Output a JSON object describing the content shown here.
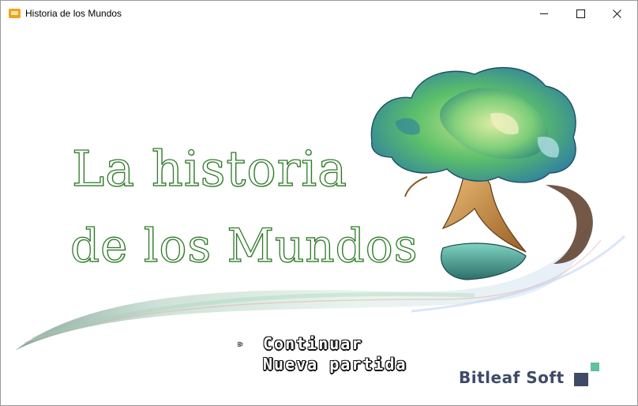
{
  "window": {
    "title": "Historia de los Mundos",
    "controls": {
      "minimize": "—",
      "maximize": "☐",
      "close": "✕"
    }
  },
  "title_screen": {
    "logo": {
      "line1": "La historia",
      "line2": "de los Mundos"
    },
    "menu": {
      "cursor_icon": "▹",
      "items": [
        {
          "label": "Continuar",
          "selected": true
        },
        {
          "label": "Nueva partida",
          "selected": false
        }
      ]
    },
    "studio": "Bitleaf Soft"
  },
  "colors": {
    "logo_green": "#2f7a2a",
    "studio_navy": "#3f4a66",
    "studio_mint": "#5fc29a"
  }
}
